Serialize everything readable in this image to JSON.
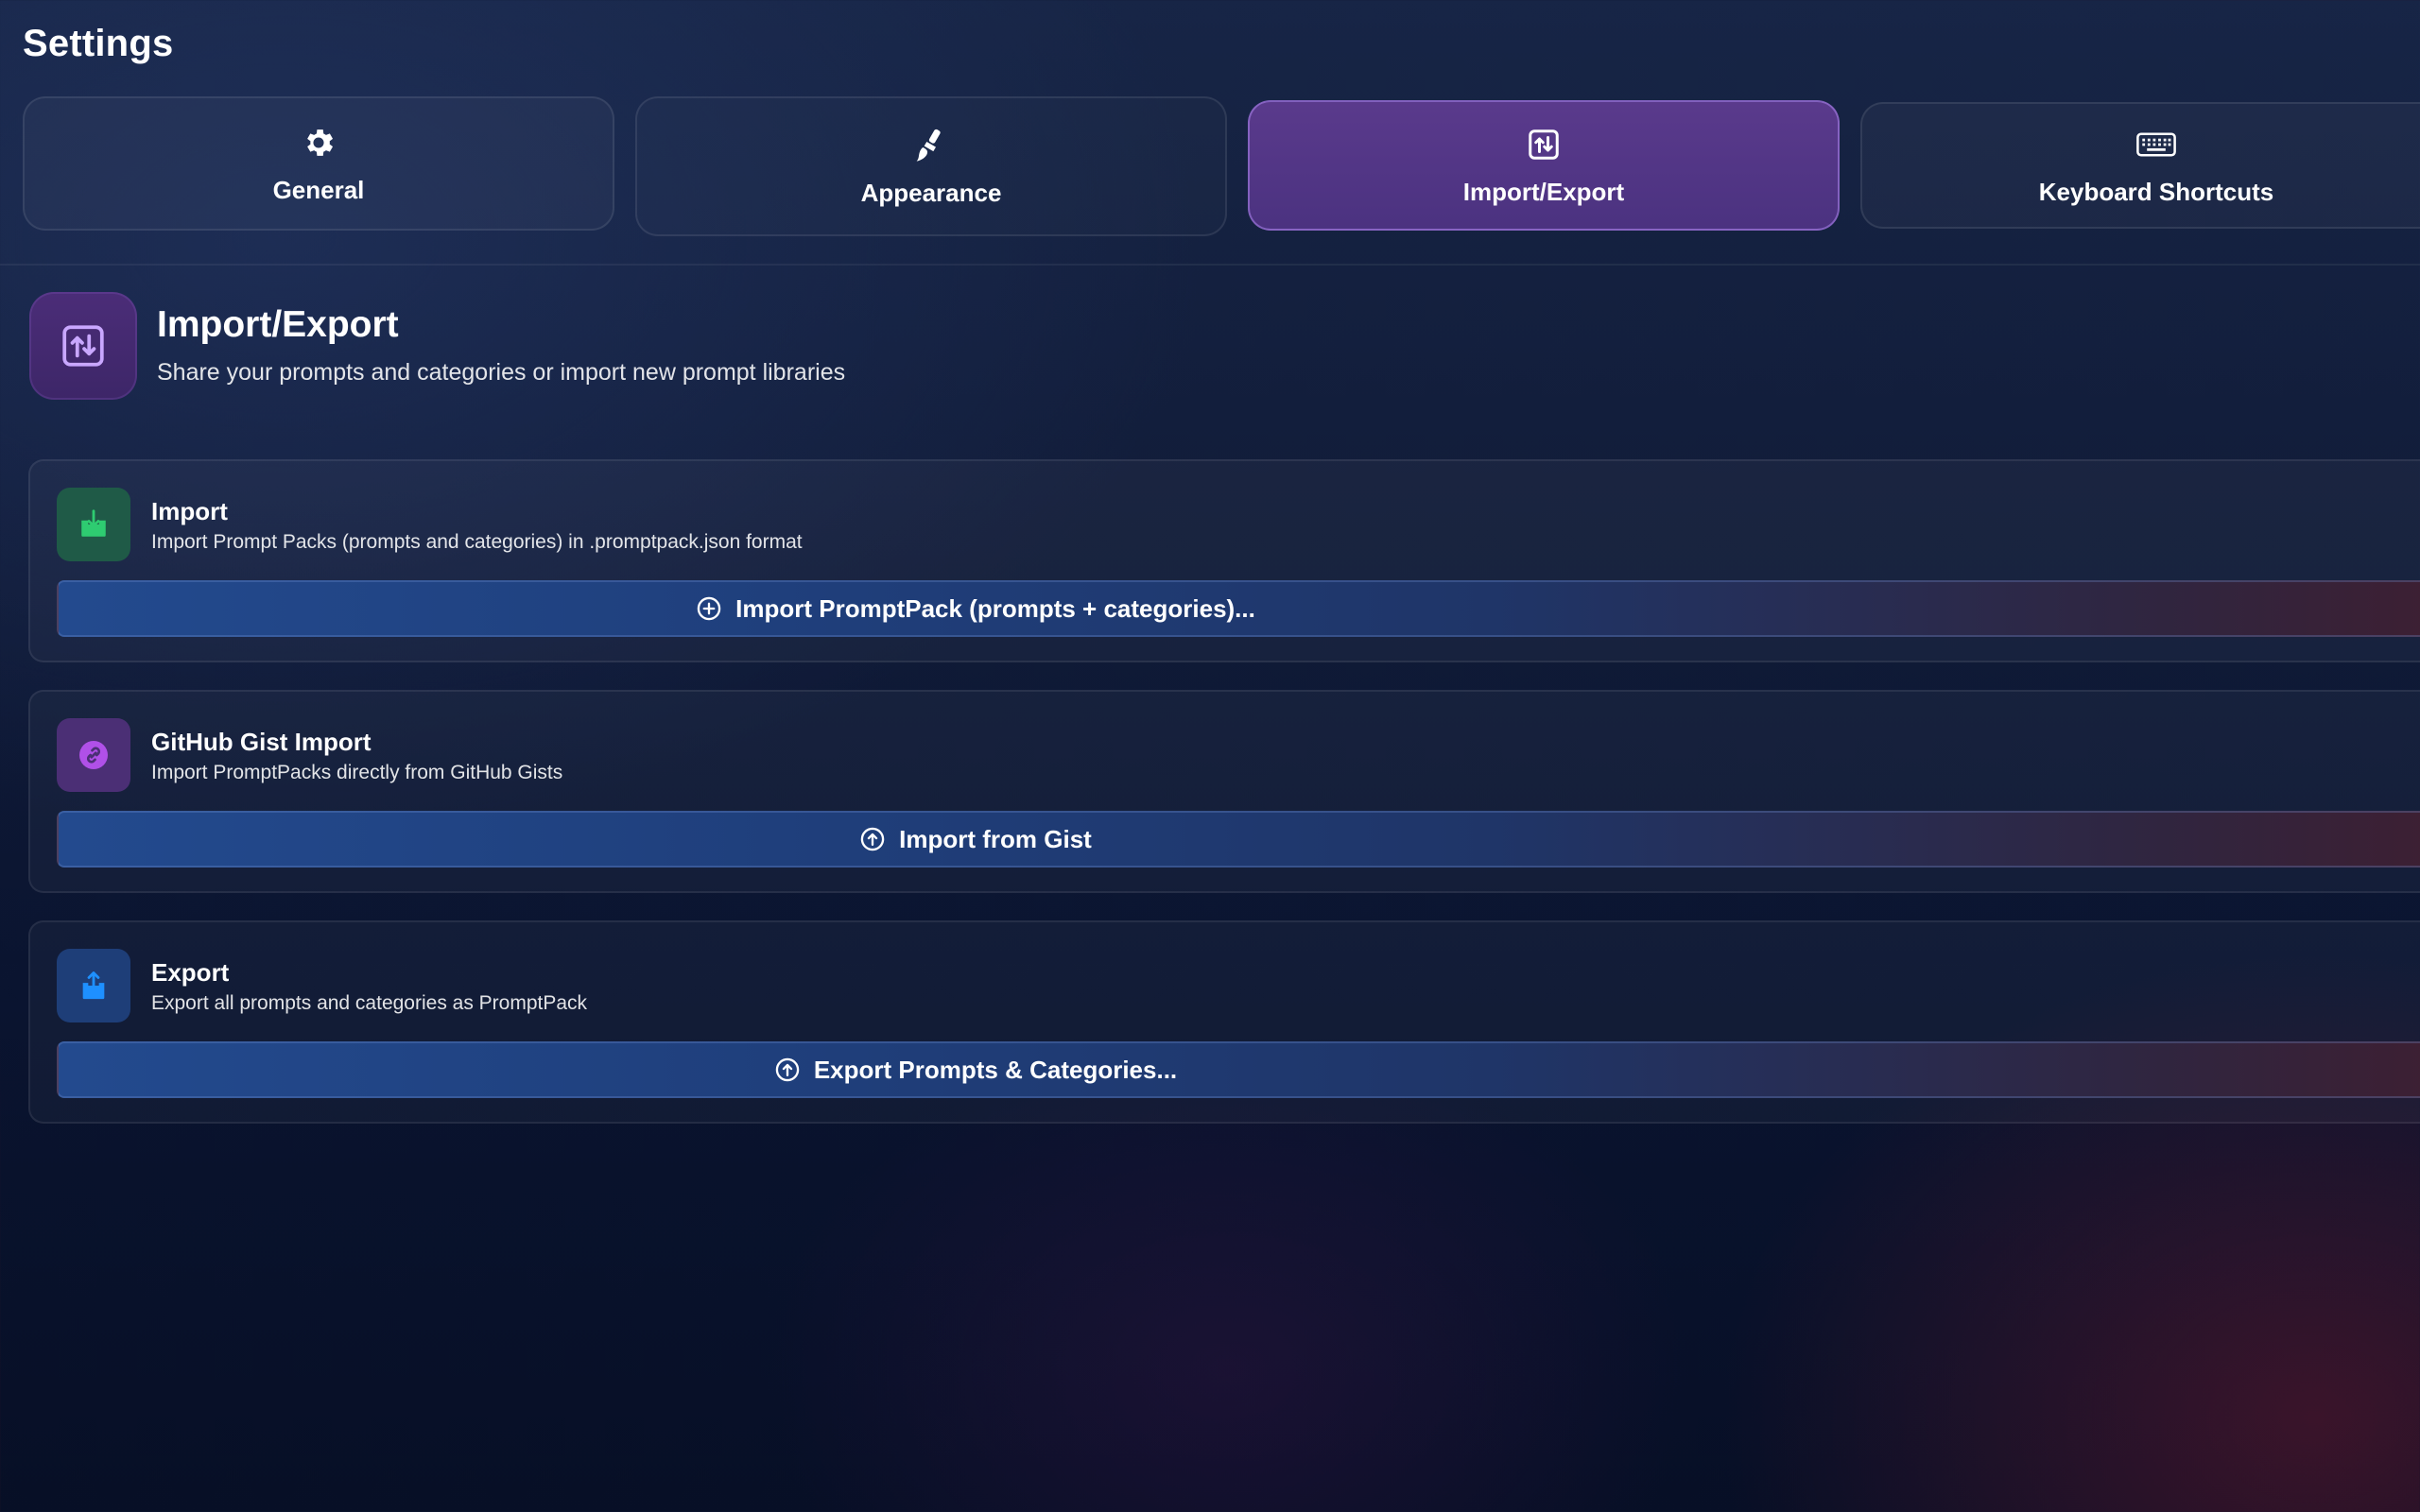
{
  "header": {
    "title": "Settings"
  },
  "tabs": [
    {
      "label": "General",
      "icon": "gear-icon"
    },
    {
      "label": "Appearance",
      "icon": "paintbrush-icon"
    },
    {
      "label": "Import/Export",
      "icon": "import-export-icon",
      "selected": true
    },
    {
      "label": "Keyboard Shortcuts",
      "icon": "keyboard-icon"
    }
  ],
  "section": {
    "title": "Import/Export",
    "subtitle": "Share your prompts and categories or import new prompt libraries",
    "icon": "import-export-icon"
  },
  "cards": [
    {
      "title": "Import",
      "description": "Import Prompt Packs (prompts and categories) in .promptpack.json format",
      "icon": "tray-download-icon",
      "button_label": "Import PromptPack (prompts + categories)...",
      "button_icon": "plus-circle-icon"
    },
    {
      "title": "GitHub Gist Import",
      "description": "Import PromptPacks directly from GitHub Gists",
      "icon": "link-icon",
      "button_label": "Import from Gist",
      "button_icon": "arrow-up-circle-icon"
    },
    {
      "title": "Export",
      "description": "Export all prompts and categories as PromptPack",
      "icon": "share-upload-icon",
      "button_label": "Export Prompts & Categories...",
      "button_icon": "arrow-up-circle-icon"
    }
  ],
  "colors": {
    "selected_tab": "#4b3280",
    "import_icon": "#2ecc71",
    "gist_icon": "#b050e8",
    "export_icon": "#1e90ff",
    "button_start": "#234a8e"
  }
}
